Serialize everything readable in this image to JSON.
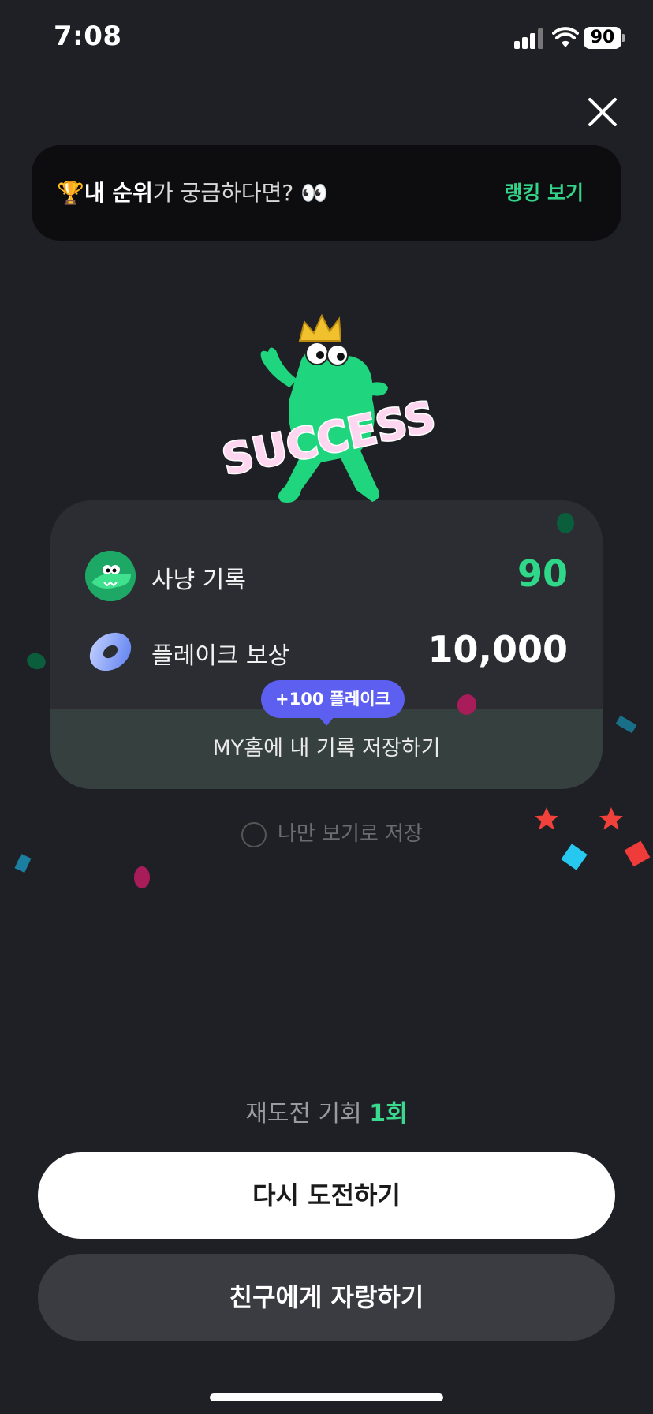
{
  "status_bar": {
    "time": "7:08",
    "battery": "90"
  },
  "banner": {
    "emoji": "🏆",
    "bold_text": "내 순위",
    "text": "가 궁금하다면? ",
    "eyes": "👀",
    "action": "랭킹 보기"
  },
  "mascot": {
    "caption": "SUCCESS"
  },
  "result": {
    "hunt_label": "사냥 기록",
    "hunt_value": "90",
    "flake_label": "플레이크 보상",
    "flake_value": "10,000",
    "tooltip": "+100 플레이크",
    "save_label": "MY홈에 내 기록 저장하기"
  },
  "private_toggle": {
    "label": "나만 보기로 저장"
  },
  "retry": {
    "prefix": "재도전 기회 ",
    "count": "1회"
  },
  "buttons": {
    "retry": "다시 도전하기",
    "share": "친구에게 자랑하기"
  },
  "colors": {
    "accent_green": "#34d38a",
    "tooltip_purple": "#5c5ff0",
    "background": "#1f2026"
  },
  "icons": [
    "signal-icon",
    "wifi-icon",
    "battery-icon",
    "close-icon",
    "trophy-icon",
    "eyes-icon",
    "crocodile-avatar-icon",
    "donut-flake-icon",
    "radio-circle-icon"
  ]
}
